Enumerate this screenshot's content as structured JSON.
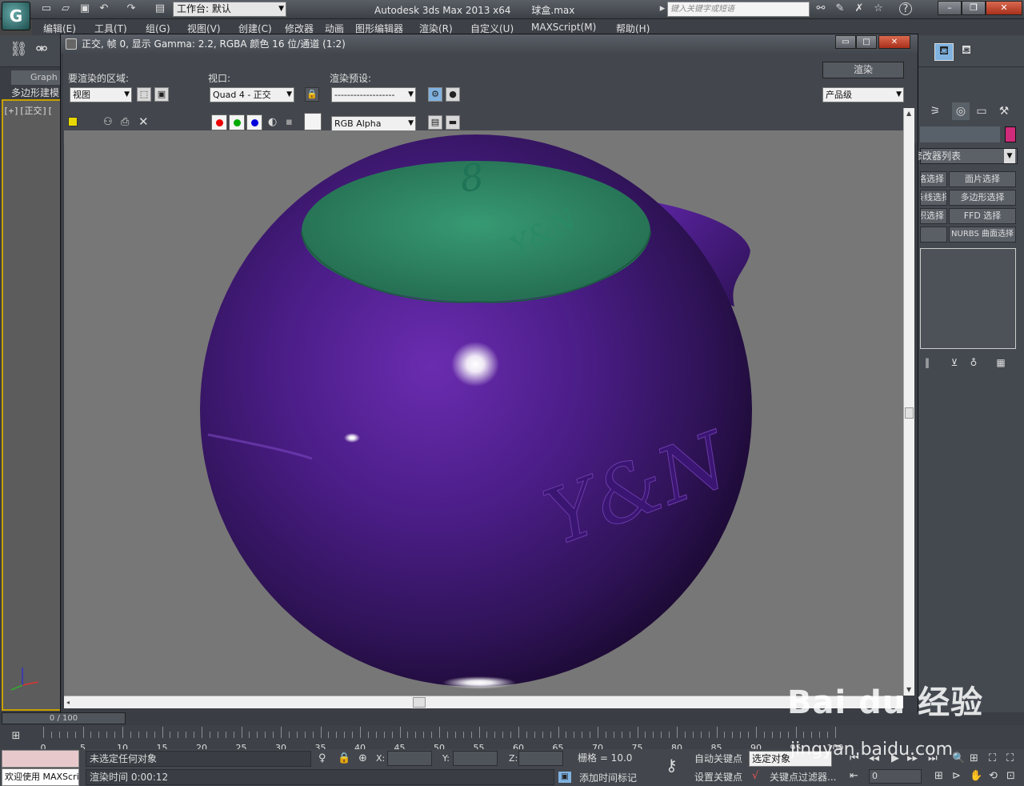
{
  "titlebar": {
    "workspace": "工作台: 默认",
    "app_title": "Autodesk 3ds Max  2013 x64",
    "file_name": "球盒.max",
    "search_placeholder": "键入关键字或短语",
    "help_label": "?",
    "minimize": "–",
    "restore": "❐",
    "close": "✕"
  },
  "menubar": {
    "items": [
      "编辑(E)",
      "工具(T)",
      "组(G)",
      "视图(V)",
      "创建(C)",
      "修改器",
      "动画",
      "图形编辑器",
      "渲染(R)",
      "自定义(U)",
      "MAXScript(M)",
      "帮助(H)"
    ]
  },
  "left": {
    "graph_tab": "Graph",
    "ribbon_label": "多边形建模",
    "viewport_label": "[+][正交]["
  },
  "render_window": {
    "title": "正交, 帧 0, 显示 Gamma: 2.2, RGBA 颜色 16 位/通道 (1:2)",
    "area_label": "要渲染的区域:",
    "area_value": "视图",
    "viewport_label": "视口:",
    "viewport_value": "Quad 4 - 正交",
    "preset_label": "渲染预设:",
    "preset_value": "-------------------",
    "render_button": "渲染",
    "quality_value": "产品级",
    "channel_value": "RGB Alpha"
  },
  "scene": {
    "lid_color": "#2f8a66",
    "ball_color": "#4a1d86",
    "background_color": "#777777",
    "lid_number": "8",
    "lid_text": "Y&N",
    "ball_text": "Y&N"
  },
  "command_panel": {
    "modifier_list": "修改器列表",
    "buttons": [
      "网格选择",
      "面片选择",
      "样条线选择",
      "多边形选择",
      "体积选择",
      "FFD 选择",
      "",
      "NURBS 曲面选择"
    ],
    "swatch_color": "#d02a7a"
  },
  "timeline": {
    "slider_label": "0 / 100",
    "ticks": [
      "0",
      "5",
      "10",
      "15",
      "20",
      "25",
      "30",
      "35",
      "40",
      "45",
      "50",
      "55",
      "60",
      "65",
      "70",
      "75",
      "80",
      "85",
      "90",
      "95",
      "100"
    ]
  },
  "status": {
    "maxscript": "欢迎使用 MAXScript",
    "selection_status": "未选定任何对象",
    "render_time": "渲染时间  0:00:12",
    "x_label": "X:",
    "y_label": "Y:",
    "z_label": "Z:",
    "grid": "栅格 = 10.0",
    "add_time_tag": "添加时间标记",
    "auto_key": "自动关键点",
    "set_key": "设置关键点",
    "selection_combo": "选定对象",
    "key_filters": "关键点过滤器...",
    "frame_value": "0"
  },
  "watermark": {
    "brand": "Bai du 经验",
    "url": "jingyan.baidu.com"
  }
}
